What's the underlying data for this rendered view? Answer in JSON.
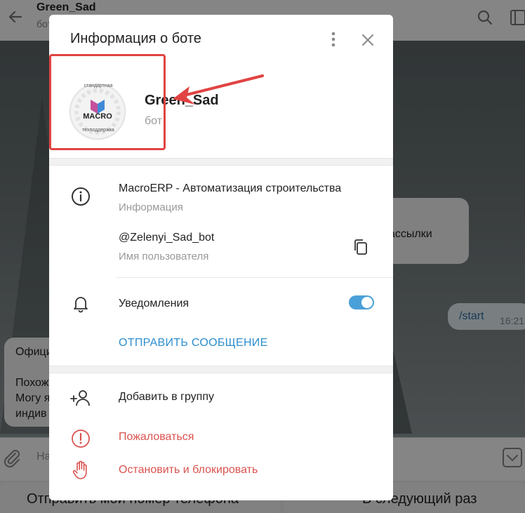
{
  "background": {
    "chat_title": "Green_Sad",
    "chat_subtitle": "бот",
    "bubble_right_text": "ассылки",
    "outgoing_command": "/start",
    "outgoing_time": "16:21",
    "left_bubble_lines": [
      "Офици",
      "Похож",
      "Могу я",
      "индив"
    ],
    "composer_placeholder": "На",
    "reply_buttons": [
      "Отправить мой номер телефона",
      "В следующий раз"
    ]
  },
  "modal": {
    "title": "Информация о боте",
    "bot_name": "Green_Sad",
    "bot_subtitle": "бот",
    "avatar": {
      "top_text": "стандартная",
      "brand": "MACRO",
      "bottom_text": "техподдержка"
    },
    "info": {
      "description": "MacroERP - Автоматизация строительства",
      "description_label": "Информация",
      "username": "@Zelenyi_Sad_bot",
      "username_label": "Имя пользователя"
    },
    "notifications": {
      "label": "Уведомления",
      "enabled": true
    },
    "send_message": "ОТПРАВИТЬ СООБЩЕНИЕ",
    "actions": {
      "add_to_group": "Добавить в группу",
      "report": "Пожаловаться",
      "stop_block": "Остановить и блокировать"
    }
  },
  "colors": {
    "accent": "#2d8ecf",
    "toggle_on": "#4aa0d8",
    "danger": "#d9534f",
    "annotation": "#e14343"
  }
}
